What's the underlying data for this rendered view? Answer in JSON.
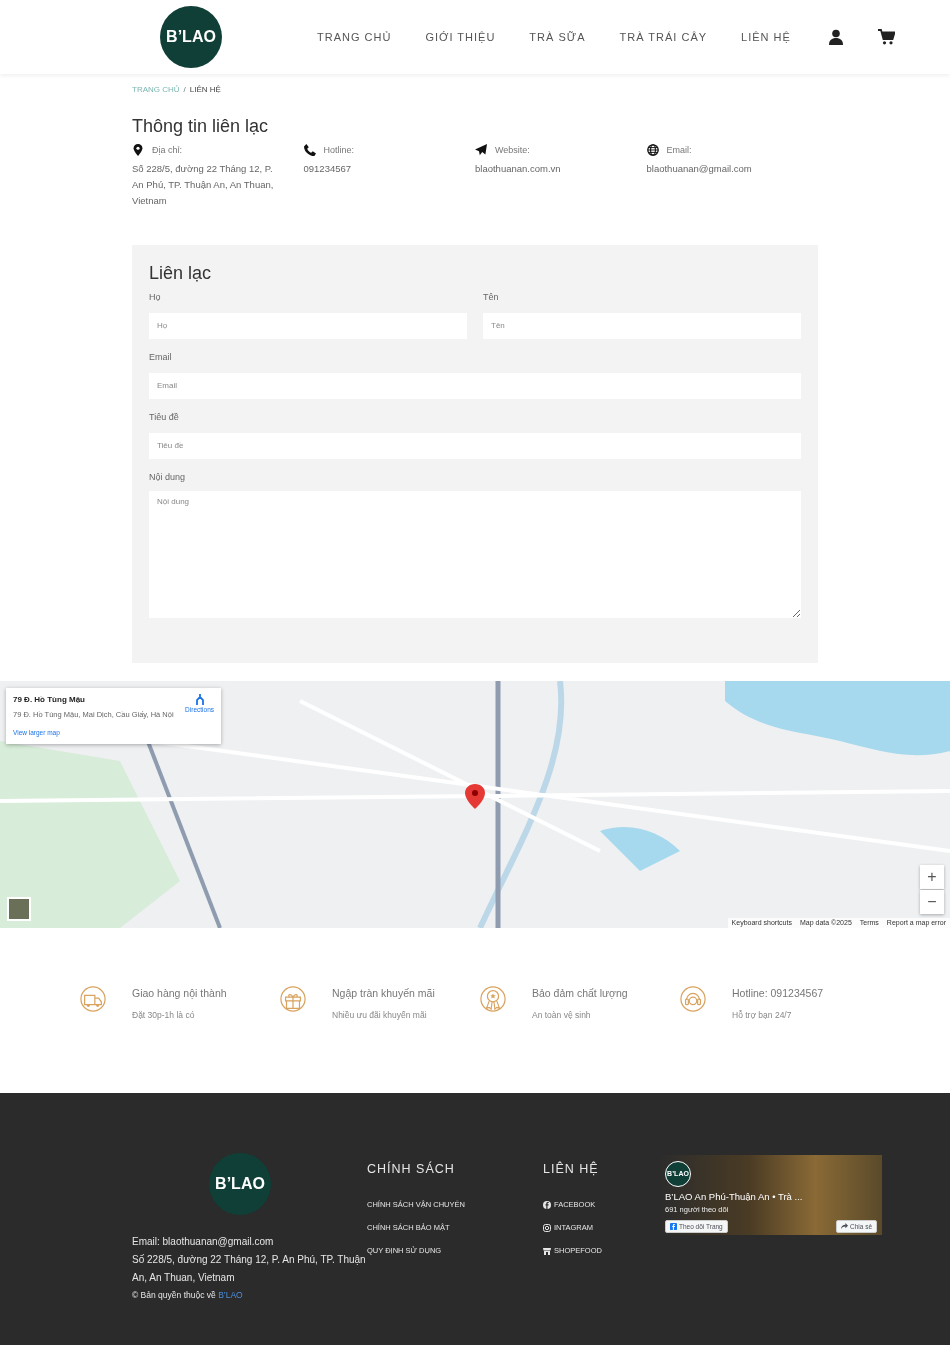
{
  "header": {
    "logo": "B’LAO",
    "nav": [
      {
        "label": "TRANG CHỦ",
        "selected": false
      },
      {
        "label": "GIỚI THIỆU",
        "selected": false
      },
      {
        "label": "TRÀ SỮA",
        "selected": false
      },
      {
        "label": "TRÀ TRÁI CÂY",
        "selected": false
      },
      {
        "label": "LIÊN HỆ",
        "selected": false
      }
    ]
  },
  "breadcrumb_separator": "/",
  "breadcrumb": [
    {
      "label": "TRANG CHỦ",
      "current": false
    },
    {
      "label": "LIÊN HỆ",
      "current": true
    }
  ],
  "contact_info": {
    "title": "Thông tin liên lạc",
    "items": [
      {
        "kind": "address",
        "label": "Địa chỉ:",
        "value": "Số 228/5, đường 22 Tháng 12, P. An Phú, TP. Thuận An, An Thuan, Vietnam"
      },
      {
        "kind": "phone",
        "label": "Hotline:",
        "value": "091234567"
      },
      {
        "kind": "website",
        "label": "Website:",
        "value": "blaothuanan.com.vn"
      },
      {
        "kind": "email",
        "label": "Email:",
        "value": "blaothuanan@gmail.com"
      }
    ]
  },
  "form": {
    "title": "Liên lạc",
    "rows": [
      [
        {
          "kind": "input",
          "label": "Họ",
          "placeholder": "Họ"
        },
        {
          "kind": "input",
          "label": "Tên",
          "placeholder": "Tên"
        }
      ],
      [
        {
          "kind": "input",
          "label": "Email",
          "placeholder": "Email"
        }
      ],
      [
        {
          "kind": "input",
          "label": "Tiêu đề",
          "placeholder": "Tiêu đề"
        }
      ],
      [
        {
          "kind": "textarea",
          "label": "Nội dung",
          "placeholder": "Nội dung"
        }
      ]
    ]
  },
  "map": {
    "place_title": "79 Đ. Hồ Tùng Mậu",
    "place_address": "79 Đ. Hồ Tùng Mậu, Mai Dịch, Cầu Giấy, Hà Nội",
    "directions": "Directions",
    "larger_map": "View larger map",
    "zoom_in": "+",
    "zoom_out": "−",
    "attribution": [
      "Keyboard shortcuts",
      "Map data ©2025",
      "Terms",
      "Report a map error"
    ]
  },
  "features": [
    {
      "kind": "delivery",
      "title": "Giao hàng nội thành",
      "subtitle": "Đặt 30p-1h là có"
    },
    {
      "kind": "gift",
      "title": "Ngập tràn khuyến mãi",
      "subtitle": "Nhiều ưu đãi khuyến mãi"
    },
    {
      "kind": "quality",
      "title": "Bảo đảm chất lượng",
      "subtitle": "An toàn vệ sinh"
    },
    {
      "kind": "support",
      "title": "Hotline: 091234567",
      "subtitle": "Hỗ trợ bạn 24/7"
    }
  ],
  "footer": {
    "logo": "B’LAO",
    "lines": [
      "Email: blaothuanan@gmail.com",
      "Số 228/5, đường 22 Tháng 12, P. An Phú, TP. Thuận An, An Thuan, Vietnam"
    ],
    "copyright": "© Bản quyền thuộc về",
    "copyright_link": "B’LAO",
    "columns": [
      {
        "title": "CHÍNH SÁCH",
        "links": [
          {
            "kind": "text",
            "label": "CHÍNH SÁCH VẬN CHUYỂN"
          },
          {
            "kind": "text",
            "label": "CHÍNH SÁCH BẢO MẬT"
          },
          {
            "kind": "text",
            "label": "QUY ĐỊNH SỬ DỤNG"
          }
        ]
      },
      {
        "title": "LIÊN HỆ",
        "links": [
          {
            "kind": "facebook",
            "label": "FACEBOOK"
          },
          {
            "kind": "instagram",
            "label": "INTAGRAM"
          },
          {
            "kind": "shop",
            "label": "SHOPEFOOD"
          }
        ]
      }
    ],
    "page_widget": {
      "logo": "B’LAO",
      "page_name": "B’LAO An Phú-Thuận An • Trà ...",
      "followers": "691 người theo dõi",
      "follow": "Theo dõi Trang",
      "share": "Chia sẻ"
    }
  }
}
